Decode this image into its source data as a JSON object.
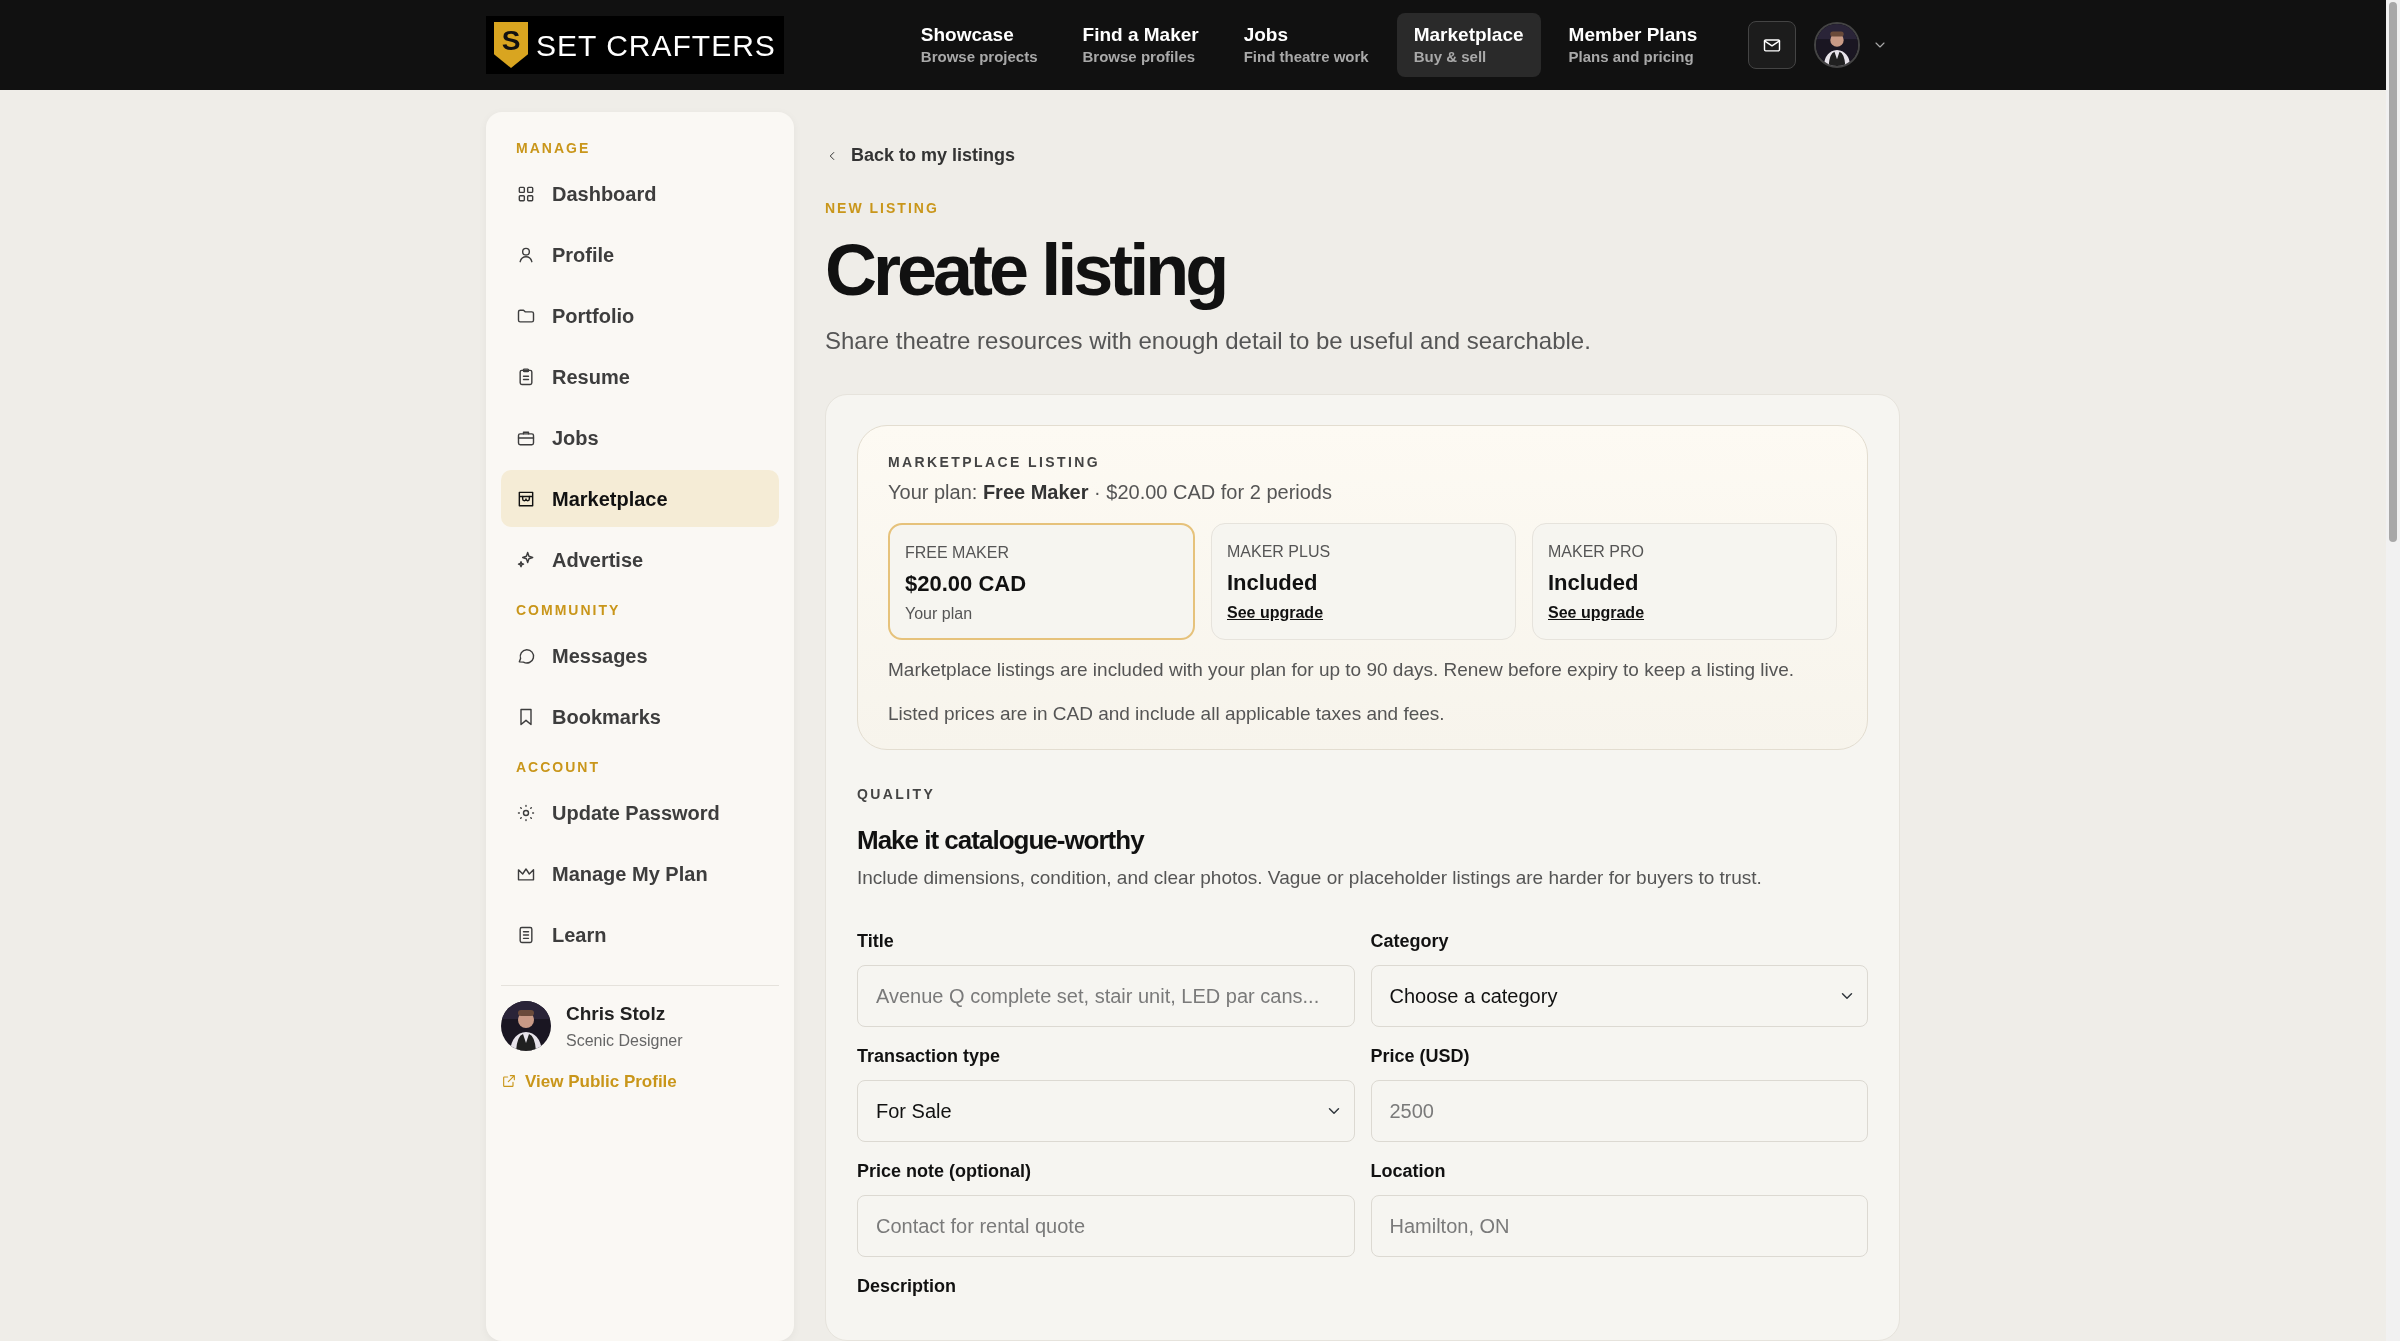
{
  "nav": {
    "logo": {
      "mark": "S",
      "text": "SET CRAFTERS"
    },
    "items": [
      {
        "title": "Showcase",
        "subtitle": "Browse projects",
        "selected": false
      },
      {
        "title": "Find a Maker",
        "subtitle": "Browse profiles",
        "selected": false
      },
      {
        "title": "Jobs",
        "subtitle": "Find theatre work",
        "selected": false
      },
      {
        "title": "Marketplace",
        "subtitle": "Buy & sell",
        "selected": true
      },
      {
        "title": "Member Plans",
        "subtitle": "Plans and pricing",
        "selected": false
      }
    ]
  },
  "sidebar": {
    "sections": [
      {
        "heading": "MANAGE",
        "items": [
          {
            "label": "Dashboard",
            "selected": false
          },
          {
            "label": "Profile",
            "selected": false
          },
          {
            "label": "Portfolio",
            "selected": false
          },
          {
            "label": "Resume",
            "selected": false
          },
          {
            "label": "Jobs",
            "selected": false
          },
          {
            "label": "Marketplace",
            "selected": true
          },
          {
            "label": "Advertise",
            "selected": false
          }
        ]
      },
      {
        "heading": "COMMUNITY",
        "items": [
          {
            "label": "Messages",
            "selected": false
          },
          {
            "label": "Bookmarks",
            "selected": false
          }
        ]
      },
      {
        "heading": "ACCOUNT",
        "items": [
          {
            "label": "Update Password",
            "selected": false
          },
          {
            "label": "Manage My Plan",
            "selected": false
          },
          {
            "label": "Learn",
            "selected": false
          }
        ]
      }
    ],
    "profile": {
      "name": "Chris Stolz",
      "role": "Scenic Designer",
      "link": "View Public Profile"
    }
  },
  "main": {
    "back_link": "Back to my listings",
    "eyebrow": "NEW LISTING",
    "title": "Create listing",
    "subtitle": "Share theatre resources with enough detail to be useful and searchable.",
    "listing_card": {
      "eyebrow": "MARKETPLACE LISTING",
      "plan_line": "Your plan: **Free Maker** · $20.00 CAD for 2 periods",
      "plans": [
        {
          "name": "FREE MAKER",
          "price": "$20.00 CAD",
          "note": "Your plan",
          "kind": "note",
          "selected": true
        },
        {
          "name": "MAKER PLUS",
          "price": "Included",
          "note": "See upgrade",
          "kind": "link",
          "selected": false
        },
        {
          "name": "MAKER PRO",
          "price": "Included",
          "note": "See upgrade",
          "kind": "link",
          "selected": false
        }
      ],
      "notes": [
        "Marketplace listings are included with your plan for up to 90 days. Renew before expiry to keep a listing live.",
        "Listed prices are in CAD and include all applicable taxes and fees."
      ]
    },
    "quality": {
      "eyebrow": "QUALITY",
      "heading": "Make it catalogue-worthy",
      "text": "Include dimensions, condition, and clear photos. Vague or placeholder listings are harder for buyers to trust."
    },
    "fields": [
      {
        "label": "Title",
        "kind": "input",
        "placeholder": "Avenue Q complete set, stair unit, LED par cans..."
      },
      {
        "label": "Category",
        "kind": "select",
        "value": "Choose a category"
      },
      {
        "label": "Transaction type",
        "kind": "select",
        "value": "For Sale"
      },
      {
        "label": "Price (USD)",
        "kind": "input",
        "placeholder": "2500"
      },
      {
        "label": "Price note (optional)",
        "kind": "input",
        "placeholder": "Contact for rental quote"
      },
      {
        "label": "Location",
        "kind": "input",
        "placeholder": "Hamilton, ON"
      }
    ],
    "description_label": "Description"
  }
}
